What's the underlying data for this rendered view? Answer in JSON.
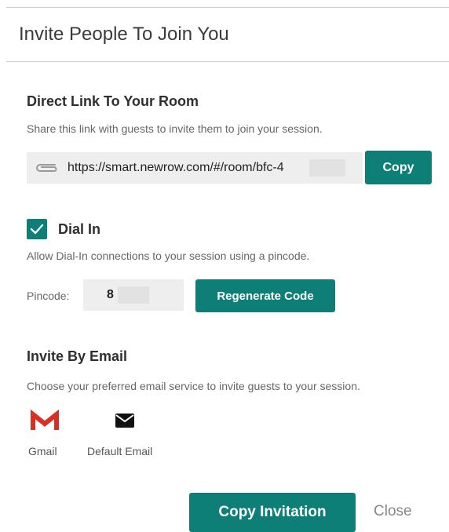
{
  "dialog": {
    "title": "Invite People To Join You"
  },
  "direct_link": {
    "title": "Direct Link To Your Room",
    "description": "Share this link with guests to invite them to join your session.",
    "url": "https://smart.newrow.com/#/room/bfc-4",
    "copy_label": "Copy"
  },
  "dial_in": {
    "checked": true,
    "label": "Dial In",
    "description": "Allow Dial-In connections to your session using a pincode.",
    "pincode_label": "Pincode:",
    "pincode_value": "8      2",
    "regenerate_label": "Regenerate Code"
  },
  "email": {
    "title": "Invite By Email",
    "description": "Choose your preferred email service to invite guests to your session.",
    "services": [
      {
        "label": "Gmail",
        "icon": "gmail-icon"
      },
      {
        "label": "Default Email",
        "icon": "envelope-icon"
      }
    ]
  },
  "footer": {
    "copy_invitation_label": "Copy Invitation",
    "close_label": "Close"
  },
  "colors": {
    "accent": "#0d7f77",
    "gmail_red": "#d93025"
  }
}
